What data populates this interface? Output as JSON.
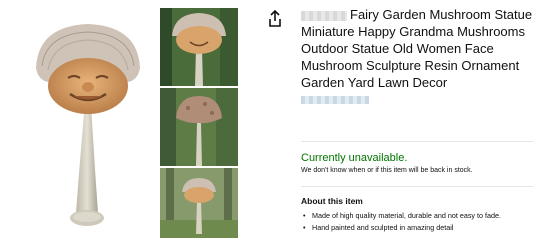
{
  "product": {
    "title": "Fairy Garden Mushroom Statue Miniature Happy Grandma Mushrooms Outdoor Statue Old Women Face Mushroom Sculpture Resin Ornament Garden Yard Lawn Decor"
  },
  "availability": {
    "status": "Currently unavailable.",
    "notice": "We don't know when or if this item will be back in stock."
  },
  "about": {
    "heading": "About this item",
    "bullets": [
      "Made of high quality material, durable and not easy to fade.",
      "Hand painted and sculpted in amazing detail"
    ]
  },
  "icons": {
    "share": "share-icon"
  },
  "colors": {
    "available_status": "#007600",
    "title_text": "#0f1111"
  }
}
